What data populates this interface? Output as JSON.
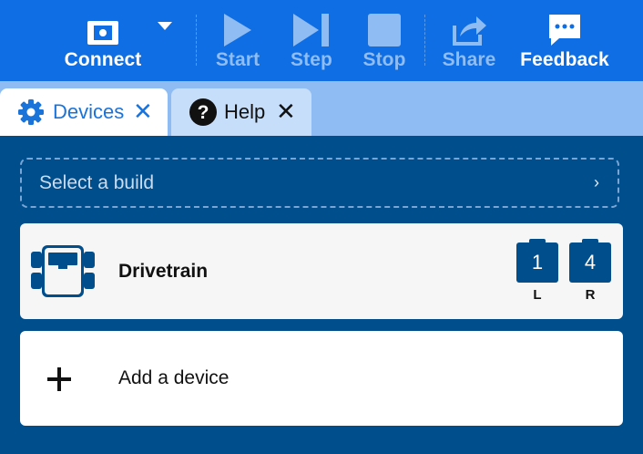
{
  "toolbar": {
    "connect": "Connect",
    "start": "Start",
    "step": "Step",
    "stop": "Stop",
    "share": "Share",
    "feedback": "Feedback"
  },
  "tabs": [
    {
      "label": "Devices",
      "icon": "gear-icon",
      "active": true
    },
    {
      "label": "Help",
      "icon": "question-icon",
      "active": false
    }
  ],
  "build_select": {
    "placeholder": "Select a build",
    "chevron": "›"
  },
  "drivetrain": {
    "label": "Drivetrain",
    "ports": [
      {
        "number": "1",
        "side": "L"
      },
      {
        "number": "4",
        "side": "R"
      }
    ]
  },
  "add_device": {
    "label": "Add a device"
  },
  "colors": {
    "toolbar": "#0f6ee3",
    "tabbar": "#8fbdf3",
    "content": "#004e8c",
    "accent": "#1a73d9",
    "disabled": "#8fbdf3"
  }
}
